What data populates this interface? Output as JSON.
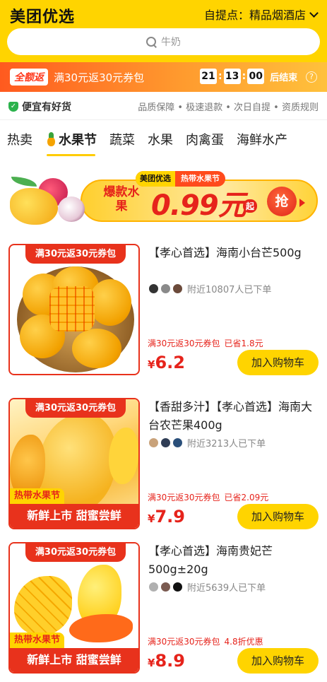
{
  "header": {
    "logo": "美团优选",
    "pickup_label": "自提点：精品烟酒店",
    "search_placeholder": "牛奶"
  },
  "promo": {
    "badge": "全额返",
    "text": "满30元返30元券包",
    "timer": {
      "h": "21",
      "m": "13",
      "s": "00"
    },
    "end_label": "后结束",
    "help_glyph": "?"
  },
  "guarantee": {
    "icon_glyph": "✓",
    "title": "便宜有好货",
    "items": "品质保障 • 极速退款 • 次日自提 • 资质规则"
  },
  "tabs": [
    "热卖",
    "水果节",
    "蔬菜",
    "水果",
    "肉禽蛋",
    "海鲜水产"
  ],
  "active_tab": 1,
  "banner": {
    "brand": "美团优选",
    "event": "热带水果节",
    "hot": "爆款水果",
    "price": "0.99元",
    "price_suffix": "起",
    "cta": "抢"
  },
  "products": [
    {
      "image_tag": "满30元返30元券包",
      "title": "【孝心首选】海南小台芒500g",
      "buyers": "附近10807人已下单",
      "coupon": "满30元返30元券包",
      "save": "已省1.8元",
      "yen": "¥",
      "price": "6.2",
      "cart": "加入购物车"
    },
    {
      "image_tag": "满30元返30元券包",
      "flash_top": "热带水果节",
      "flash_bottom": "新鲜上市 甜蜜尝鲜",
      "title": "【香甜多汁】【孝心首选】海南大台农芒果400g",
      "buyers": "附近3213人已下单",
      "coupon": "满30元返30元券包",
      "save": "已省2.09元",
      "yen": "¥",
      "price": "7.9",
      "cart": "加入购物车"
    },
    {
      "image_tag": "满30元返30元券包",
      "flash_top": "热带水果节",
      "flash_bottom": "新鲜上市 甜蜜尝鲜",
      "title": "【孝心首选】海南贵妃芒500g±20g",
      "buyers": "附近5639人已下单",
      "coupon": "满30元返30元券包",
      "save": "4.8折优惠",
      "yen": "¥",
      "price": "8.9",
      "cart": "加入购物车"
    }
  ]
}
